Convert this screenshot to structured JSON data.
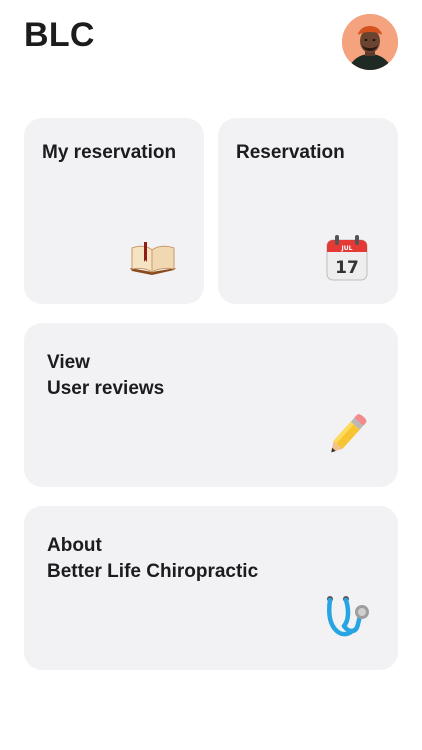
{
  "header": {
    "title": "BLC"
  },
  "cards": {
    "my_reservation": {
      "label": "My reservation",
      "icon": "open-book-icon"
    },
    "reservation": {
      "label": "Reservation",
      "icon": "calendar-icon",
      "calendar_month": "JUL",
      "calendar_day": "17"
    },
    "reviews": {
      "line1": "View",
      "line2": "User reviews",
      "icon": "pencil-icon"
    },
    "about": {
      "line1": "About",
      "line2": "Better Life Chiropractic",
      "icon": "stethoscope-icon"
    }
  },
  "colors": {
    "card_background": "#f2f2f4",
    "text": "#1c1c1e",
    "avatar_background": "#f5a27e"
  }
}
